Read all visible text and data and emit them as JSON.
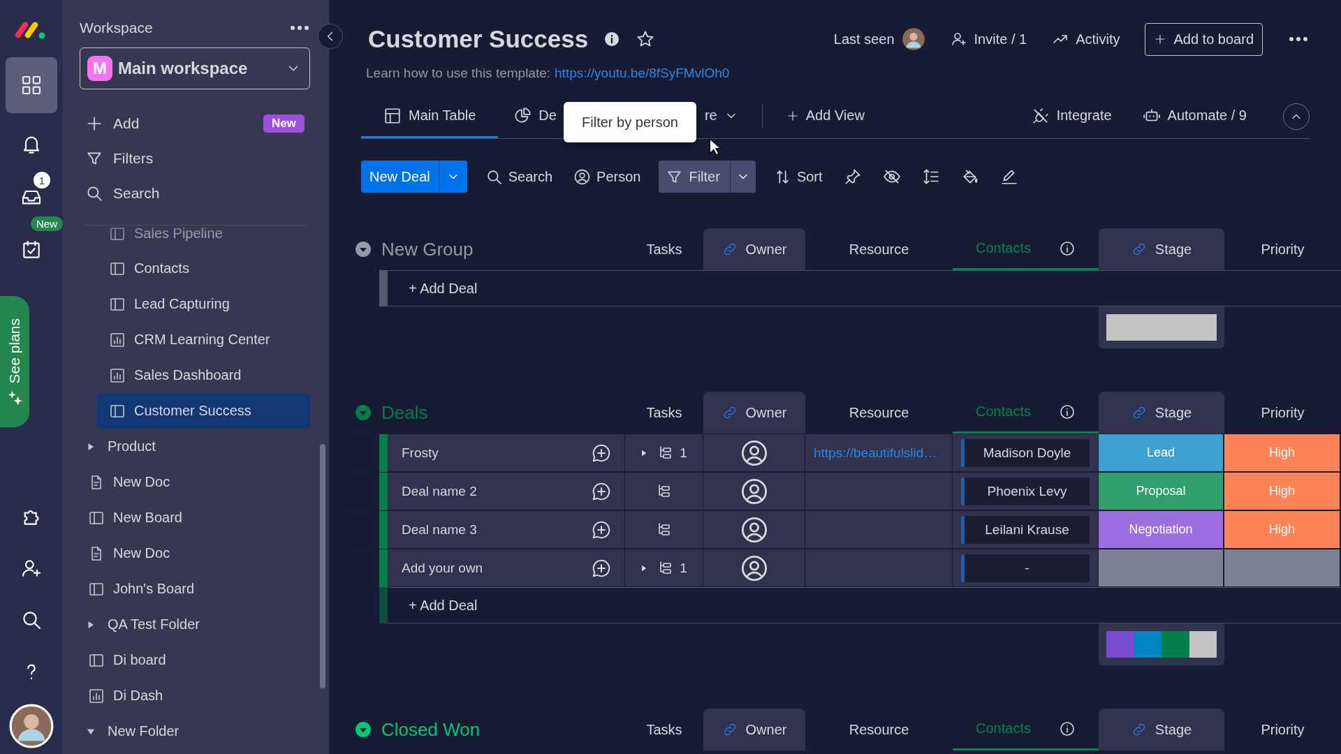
{
  "rail": {
    "items": [
      {
        "kind": "apps",
        "selected": true
      },
      {
        "kind": "notifications",
        "selected": false
      },
      {
        "kind": "inbox",
        "selected": false,
        "badge": {
          "text": "1",
          "kind": "count"
        }
      },
      {
        "kind": "my_work",
        "selected": false,
        "badge": {
          "text": "New",
          "kind": "new"
        }
      }
    ],
    "see_plans": "See plans",
    "bottom_items": [
      {
        "kind": "apps_marketplace"
      },
      {
        "kind": "invite"
      },
      {
        "kind": "search"
      },
      {
        "kind": "help"
      }
    ]
  },
  "sidebar": {
    "title": "Workspace",
    "workspace": {
      "initial": "M",
      "name": "Main workspace"
    },
    "actions": [
      {
        "kind": "add",
        "label": "Add",
        "badge": "New"
      },
      {
        "kind": "filter",
        "label": "Filters"
      },
      {
        "kind": "search",
        "label": "Search"
      }
    ],
    "folder_items": [
      {
        "kind": "board",
        "label": "Sales Pipeline",
        "selected": false
      },
      {
        "kind": "board",
        "label": "Contacts",
        "selected": false
      },
      {
        "kind": "board",
        "label": "Lead Capturing",
        "selected": false
      },
      {
        "kind": "dashboard",
        "label": "CRM Learning Center",
        "selected": false
      },
      {
        "kind": "dashboard",
        "label": "Sales Dashboard",
        "selected": false
      },
      {
        "kind": "board",
        "label": "Customer Success",
        "selected": true
      }
    ],
    "items": [
      {
        "kind": "folder",
        "label": "Product",
        "expanded": false,
        "selected": false
      },
      {
        "kind": "doc",
        "label": "New Doc",
        "selected": false
      },
      {
        "kind": "board",
        "label": "New Board",
        "selected": false
      },
      {
        "kind": "doc",
        "label": "New Doc",
        "selected": false
      },
      {
        "kind": "board",
        "label": "John's Board",
        "selected": false
      },
      {
        "kind": "folder",
        "label": "QA Test Folder",
        "expanded": false,
        "selected": false
      },
      {
        "kind": "board",
        "label": "Di board",
        "selected": false
      },
      {
        "kind": "dashboard",
        "label": "Di Dash",
        "selected": false
      },
      {
        "kind": "folder",
        "label": "New Folder",
        "expanded": true,
        "selected": false
      }
    ]
  },
  "board": {
    "title": "Customer Success",
    "favorite": false,
    "description": "Learn how to use this template:",
    "link": "https://youtu.be/8fSyFMvlOh0",
    "last_seen": "Last seen",
    "invite": "Invite / 1",
    "activity": "Activity",
    "add_button": "Add to board"
  },
  "views": {
    "tabs": [
      {
        "label": "Main Table",
        "kind": "table",
        "selected": true
      },
      {
        "label": "De",
        "kind": "chart",
        "selected": false
      },
      {
        "label": "re",
        "kind": "more",
        "selected": false
      }
    ],
    "add_view": "Add View",
    "integrate": "Integrate",
    "automate": "Automate / 9"
  },
  "tooltip": "Filter by person",
  "toolbar": {
    "new_button": "New Deal",
    "tools": [
      {
        "kind": "search",
        "label": "Search",
        "active": false
      },
      {
        "kind": "person",
        "label": "Person",
        "active": false
      },
      {
        "kind": "filter",
        "label": "Filter",
        "active": true
      },
      {
        "kind": "sort",
        "label": "Sort",
        "active": false
      },
      {
        "kind": "pin",
        "active": false
      },
      {
        "kind": "hide",
        "active": false
      },
      {
        "kind": "row_height",
        "active": false
      },
      {
        "kind": "color",
        "active": false
      },
      {
        "kind": "edit",
        "active": false
      }
    ]
  },
  "groups": [
    {
      "name": "New Group",
      "color": "#9699a6",
      "columns": [
        {
          "label": "Tasks",
          "kind": "plain"
        },
        {
          "label": "Owner",
          "kind": "linked"
        },
        {
          "label": "Resource",
          "kind": "plain"
        },
        {
          "label": "Contacts",
          "kind": "mirror"
        },
        {
          "label": "Stage",
          "kind": "linked"
        },
        {
          "label": "Priority",
          "kind": "plain"
        }
      ],
      "add_label": "+ Add Deal",
      "summary": [
        {
          "color": "#c4c4c4"
        }
      ]
    },
    {
      "name": "Deals",
      "color": "#037f4c",
      "columns": [
        {
          "label": "Tasks",
          "kind": "plain"
        },
        {
          "label": "Owner",
          "kind": "linked"
        },
        {
          "label": "Resource",
          "kind": "plain"
        },
        {
          "label": "Contacts",
          "kind": "mirror"
        },
        {
          "label": "Stage",
          "kind": "linked"
        },
        {
          "label": "Priority",
          "kind": "plain"
        }
      ],
      "rows": [
        {
          "name": "Frosty",
          "subitems": "1",
          "resource": "https://beautifulslid…",
          "contact": "Madison Doyle",
          "stage": {
            "label": "Lead",
            "color": "#3ea0cf"
          },
          "priority": {
            "label": "High",
            "color": "#fd8456"
          }
        },
        {
          "name": "Deal name 2",
          "contact": "Phoenix Levy",
          "stage": {
            "label": "Proposal",
            "color": "#2f9e6c"
          },
          "priority": {
            "label": "High",
            "color": "#fd8456"
          }
        },
        {
          "name": "Deal name 3",
          "contact": "Leilani Krause",
          "stage": {
            "label": "Negotiation",
            "color": "#9b6fe0"
          },
          "priority": {
            "label": "High",
            "color": "#fd8456"
          }
        },
        {
          "name": "Add your own",
          "subitems": "1",
          "contact": "-",
          "stage": {
            "color": "#7d8196"
          },
          "priority": {
            "color": "#7d8196"
          }
        }
      ],
      "add_label": "+ Add Deal",
      "summary": [
        {
          "color": "#784bd1"
        },
        {
          "color": "#0086c0"
        },
        {
          "color": "#037f4c"
        },
        {
          "color": "#c4c4c4"
        }
      ]
    },
    {
      "name": "Closed Won",
      "color": "#00c875",
      "columns": [
        {
          "label": "Tasks",
          "kind": "plain"
        },
        {
          "label": "Owner",
          "kind": "linked"
        },
        {
          "label": "Resource",
          "kind": "plain"
        },
        {
          "label": "Contacts",
          "kind": "mirror"
        },
        {
          "label": "Stage",
          "kind": "linked"
        },
        {
          "label": "Priority",
          "kind": "plain"
        }
      ]
    }
  ]
}
